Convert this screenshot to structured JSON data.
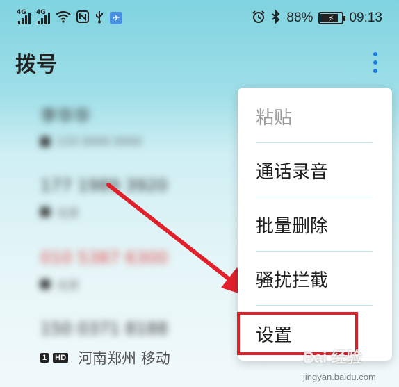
{
  "status_bar": {
    "signal1_label": "4G",
    "signal2_label": "4G",
    "battery_percent": "88%",
    "time": "09:13",
    "icons": [
      "signal-icon",
      "signal-icon",
      "wifi-icon",
      "nfc-icon",
      "usb-icon",
      "app-notification-icon",
      "alarm-icon",
      "bluetooth-icon",
      "battery-icon"
    ]
  },
  "header": {
    "title": "拨号",
    "more_icon": "more-vertical-icon"
  },
  "call_log": {
    "items": [
      {
        "name": "李华华",
        "sub": "133 0000 0000",
        "missed": false
      },
      {
        "name": "177 1989 3920",
        "sub": "北京",
        "missed": false
      },
      {
        "name": "010 5387 6300",
        "sub": "北京",
        "missed": true
      },
      {
        "name": "150 0371 8188",
        "sub": "河南郑州 移动",
        "missed": false
      }
    ],
    "visible_sub": {
      "sim_badge": "1",
      "hd_badge": "HD",
      "location": "河南郑州 移动"
    }
  },
  "menu": {
    "items": [
      {
        "label": "粘贴",
        "disabled": true
      },
      {
        "label": "通话录音",
        "disabled": false
      },
      {
        "label": "批量删除",
        "disabled": false
      },
      {
        "label": "骚扰拦截",
        "disabled": false
      },
      {
        "label": "设置",
        "disabled": false,
        "highlighted": true
      }
    ]
  },
  "annotation": {
    "arrow_color": "#e0202a",
    "highlight_color": "#e0202a"
  },
  "watermark": {
    "main": "Bai 经验",
    "sub": "jingyan.baidu.com"
  },
  "colors": {
    "accent": "#1e7fe0",
    "background_top": "#7fd3e0",
    "menu_bg": "#ffffff",
    "missed_call": "#e34a4a"
  }
}
